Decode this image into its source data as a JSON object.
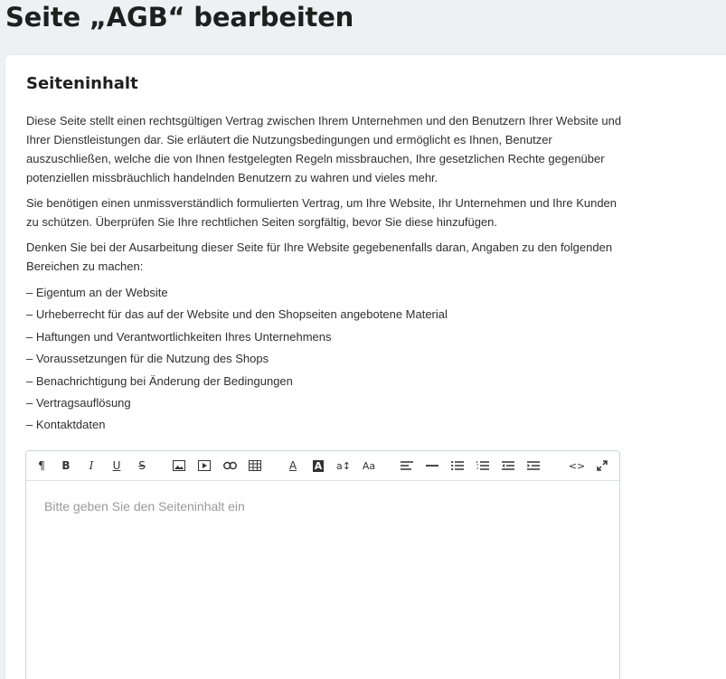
{
  "page": {
    "title": "Seite „AGB“ bearbeiten"
  },
  "section": {
    "title": "Seiteninhalt",
    "paragraphs": [
      "Diese Seite stellt einen rechtsgültigen Vertrag zwischen Ihrem Unternehmen und den Benutzern Ihrer Website und Ihrer Dienstleistungen dar. Sie erläutert die Nutzungsbedingungen und ermöglicht es Ihnen, Benutzer auszuschließen, welche die von Ihnen festgelegten Regeln missbrauchen, Ihre gesetzlichen Rechte gegenüber potenziellen missbräuchlich handelnden Benutzern zu wahren und vieles mehr.",
      "Sie benötigen einen unmissverständlich formulierten Vertrag, um Ihre Website, Ihr Unternehmen und Ihre Kunden zu schützen. Überprüfen Sie Ihre rechtlichen Seiten sorgfältig, bevor Sie diese hinzufügen.",
      "Denken Sie bei der Ausarbeitung dieser Seite für Ihre Website gegebenenfalls daran, Angaben zu den folgenden Bereichen zu machen:"
    ],
    "items": [
      "Eigentum an der Website",
      "Urheberrecht für das auf der Website und den Shopseiten angebotene Material",
      "Haftungen und Verantwortlichkeiten Ihres Unternehmens",
      "Voraussetzungen für die Nutzung des Shops",
      "Benachrichtigung bei Änderung der Bedingungen",
      "Vertragsauflösung",
      "Kontaktdaten"
    ]
  },
  "editor": {
    "placeholder": "Bitte geben Sie den Seiteninhalt ein",
    "toolbar": {
      "paragraph": "¶",
      "bold": "B",
      "italic": "I",
      "underline": "U",
      "strike": "S",
      "font_color": "A",
      "bg_color": "A",
      "font_size": "a↕",
      "font_case": "Aa",
      "code": "<>"
    }
  },
  "icons": [
    "paragraph-icon",
    "bold-icon",
    "italic-icon",
    "underline-icon",
    "strikethrough-icon",
    "image-icon",
    "video-icon",
    "link-icon",
    "table-icon",
    "font-color-icon",
    "background-color-icon",
    "font-size-icon",
    "text-case-icon",
    "align-icon",
    "horizontal-rule-icon",
    "bullet-list-icon",
    "numbered-list-icon",
    "outdent-icon",
    "indent-icon",
    "code-view-icon",
    "fullscreen-icon"
  ]
}
